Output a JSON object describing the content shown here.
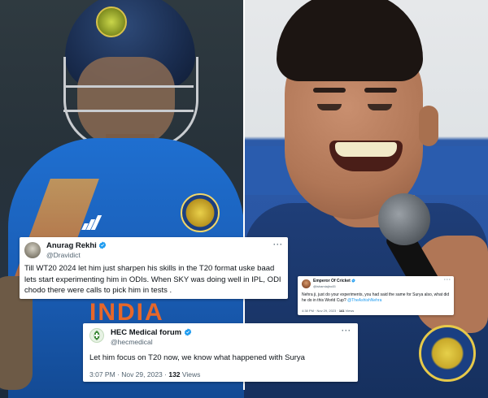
{
  "photo_left": {
    "chest_text": "INDIA"
  },
  "tweets": [
    {
      "name": "Anurag Rekhi",
      "handle": "@Dravidict",
      "more": "···",
      "text": "Till WT20 2024 let him just sharpen his skills in the T20 format uske baad lets start experimenting him in ODIs. When SKY was doing well in IPL, ODI chodo there were calls to pick him in tests ."
    },
    {
      "name": "Emperor Of Cricket",
      "handle": "@ishamiajiro45",
      "more": "···",
      "text": "Nehra ji, just do your experiments, you had said the same for Surya also, what did he do in this World Cup?",
      "link": "@TheAshishNehra",
      "time": "4:38 PM · Nov 29, 2023 ·",
      "views_count": "141",
      "views_label": "Views"
    },
    {
      "name": "HEC Medical forum",
      "handle": "@hecmedical",
      "more": "···",
      "text": "Let him focus on T20 now, we know what happened with  Surya",
      "time": "3:07 PM · Nov 29, 2023 ·",
      "views_count": "132",
      "views_label": "Views"
    }
  ],
  "colors": {
    "verified_badge": "#1d9bf0",
    "link": "#1d9bf0",
    "jersey_blue": "#1f6fd0",
    "jersey_orange": "#e6672a"
  },
  "icons": [
    "verified-badge-icon",
    "more-options-icon",
    "avatar-image"
  ]
}
